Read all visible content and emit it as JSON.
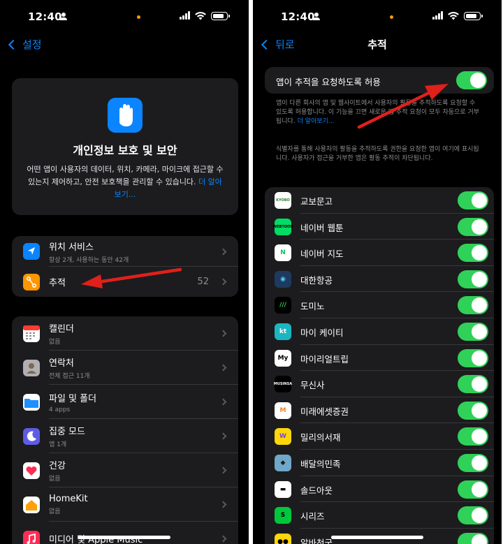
{
  "status": {
    "time": "12:40"
  },
  "left": {
    "nav": {
      "back_label": "설정"
    },
    "hero": {
      "title": "개인정보 보호 및 보안",
      "description": "어떤 앱이 사용자의 데이터, 위치, 카메라, 마이크에 접근할 수 있는지 제어하고, 안전 보호책을 관리할 수 있습니다.",
      "link": "더 알아보기..."
    },
    "group1": [
      {
        "title": "위치 서비스",
        "subtitle": "항상 2개, 사용하는 동안 42개",
        "icon": "location-arrow-icon",
        "color": "#0a84ff"
      },
      {
        "title": "추적",
        "badge": "52",
        "icon": "tracking-icon",
        "color": "#ff9500"
      }
    ],
    "group2": [
      {
        "title": "캘린더",
        "subtitle": "없음",
        "icon": "calendar-icon",
        "color": "#ffffff"
      },
      {
        "title": "연락처",
        "subtitle": "전체 접근 11개",
        "icon": "contacts-icon",
        "color": "#b7b7b7"
      },
      {
        "title": "파일 및 폴더",
        "subtitle": "4 apps",
        "icon": "folder-icon",
        "color": "#1e90ff"
      },
      {
        "title": "집중 모드",
        "subtitle": "앱 1개",
        "icon": "moon-icon",
        "color": "#5e5ce6"
      },
      {
        "title": "건강",
        "subtitle": "없음",
        "icon": "heart-icon",
        "color": "#ffffff"
      },
      {
        "title": "HomeKit",
        "subtitle": "없음",
        "icon": "home-icon",
        "color": "#ff9f0a"
      },
      {
        "title": "미디어 및 Apple Music",
        "subtitle": "",
        "icon": "music-icon",
        "color": "#ff2d55"
      }
    ]
  },
  "right": {
    "nav": {
      "back_label": "뒤로",
      "title": "추적"
    },
    "allow_toggle": {
      "label": "앱이 추적을 요청하도록 허용",
      "on": true
    },
    "note1": "앱이 다른 회사의 앱 및 웹사이트에서 사용자의 활동을 추적하도록 요청할 수 있도록 허용합니다. 이 기능을 끄면 새로운 앱 추적 요청이 모두 자동으로 거부됩니다.",
    "note1_link": "더 알아보기...",
    "note2": "식별자를 통해 사용자의 활동을 추적하도록 권한을 요청한 앱이 여기에 표시됩니다. 사용자가 접근을 거부한 앱은 활동 추적이 차단됩니다.",
    "apps": [
      {
        "name": "교보문고",
        "icon_text": "KYOBO",
        "bg": "#ffffff",
        "fg": "#2e7d32",
        "on": true
      },
      {
        "name": "네이버 웹툰",
        "icon_text": "WEBTOON",
        "bg": "#00dc64",
        "fg": "#000000",
        "on": true
      },
      {
        "name": "네이버 지도",
        "icon_text": "N",
        "bg": "#ffffff",
        "fg": "#03c75a",
        "on": true
      },
      {
        "name": "대한항공",
        "icon_text": "◉",
        "bg": "#1f3a5f",
        "fg": "#5ac8fa",
        "on": true
      },
      {
        "name": "도미노",
        "icon_text": "///",
        "bg": "#000000",
        "fg": "#30d158",
        "on": true
      },
      {
        "name": "마이 케이티",
        "icon_text": "kt",
        "bg": "#1bb6c1",
        "fg": "#ffffff",
        "on": true
      },
      {
        "name": "마이리얼트립",
        "icon_text": "My",
        "bg": "#ffffff",
        "fg": "#000000",
        "on": true
      },
      {
        "name": "무신사",
        "icon_text": "MUSINSA",
        "bg": "#000000",
        "fg": "#ffffff",
        "on": true
      },
      {
        "name": "미래에셋증권",
        "icon_text": "M",
        "bg": "#ffffff",
        "fg": "#f58220",
        "on": true
      },
      {
        "name": "밀리의서재",
        "icon_text": "W",
        "bg": "#ffd60a",
        "fg": "#7b3fe4",
        "on": true
      },
      {
        "name": "배달의민족",
        "icon_text": "◆",
        "bg": "#6fa8c8",
        "fg": "#1c1c1e",
        "on": true
      },
      {
        "name": "솔드아웃",
        "icon_text": "▬",
        "bg": "#ffffff",
        "fg": "#000000",
        "on": true
      },
      {
        "name": "시리즈",
        "icon_text": "S",
        "bg": "#00c73c",
        "fg": "#000000",
        "on": true
      },
      {
        "name": "알바천국",
        "icon_text": "●●",
        "bg": "#ffd60a",
        "fg": "#000000",
        "on": true
      }
    ]
  }
}
